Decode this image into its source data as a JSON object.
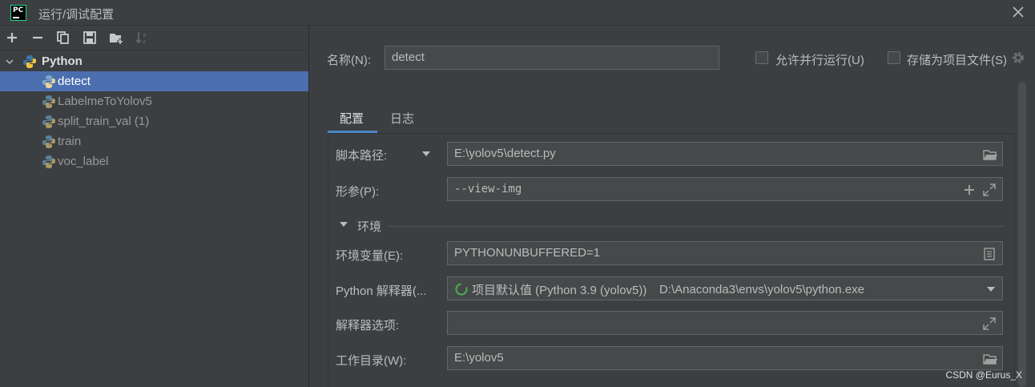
{
  "window": {
    "title": "运行/调试配置",
    "app_icon_text": "PC"
  },
  "toolbar": {
    "buttons": [
      "add-icon",
      "remove-icon",
      "copy-icon",
      "save-icon",
      "new-folder-icon",
      "sort-icon"
    ]
  },
  "tree": {
    "root": "Python",
    "items": [
      "detect",
      "LabelmeToYolov5",
      "split_train_val (1)",
      "train",
      "voc_label"
    ],
    "selected": "detect"
  },
  "header": {
    "name_label": "名称(N):",
    "name_value": "detect",
    "allow_parallel_label": "允许并行运行(U)",
    "store_as_file_label": "存储为项目文件(S)"
  },
  "tabs": [
    {
      "label": "配置",
      "active": true
    },
    {
      "label": "日志",
      "active": false
    }
  ],
  "form": {
    "script_path_label": "脚本路径:",
    "script_path_value": "E:\\yolov5\\detect.py",
    "params_label": "形参(P):",
    "params_value": "--view-img",
    "env_section": "环境",
    "env_vars_label": "环境变量(E):",
    "env_vars_value": "PYTHONUNBUFFERED=1",
    "interpreter_label": "Python 解释器(...",
    "interpreter_value": "项目默认值 (Python 3.9 (yolov5))",
    "interpreter_path": "D:\\Anaconda3\\envs\\yolov5\\python.exe",
    "interpreter_options_label": "解释器选项:",
    "interpreter_options_value": "",
    "working_dir_label": "工作目录(W):",
    "working_dir_value": "E:\\yolov5"
  },
  "watermark": "CSDN @Eurus_X",
  "colors": {
    "background": "#3c3f41",
    "selection": "#4b6eaf",
    "field": "#45494a",
    "accent": "#4a88c7"
  }
}
